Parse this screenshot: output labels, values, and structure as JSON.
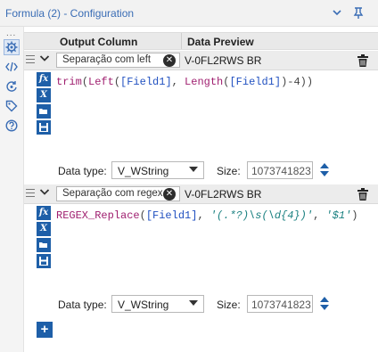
{
  "window": {
    "title": "Formula (2) - Configuration",
    "collapse_icon": "chevron-down-icon",
    "pin_icon": "pin-icon"
  },
  "sidebar": {
    "more_label": "...",
    "items": [
      {
        "name": "gear-icon",
        "glyph": "⚙"
      },
      {
        "name": "code-icon",
        "glyph": "</>"
      },
      {
        "name": "rename-icon",
        "glyph": "⟳"
      },
      {
        "name": "tag-icon",
        "glyph": "⌂"
      },
      {
        "name": "help-icon",
        "glyph": "?"
      }
    ]
  },
  "table": {
    "header_output": "Output Column",
    "header_preview": "Data Preview"
  },
  "formulas": [
    {
      "column": "Separação com left",
      "preview": "V-0FL2RWS BR",
      "expression": {
        "a": "trim",
        "b": "(",
        "c": "Left",
        "d": "(",
        "e": "[Field1]",
        "f": ", ",
        "g": "Length",
        "h": "(",
        "i": "[Field1]",
        "j": ")-4))"
      },
      "data_type_label": "Data type:",
      "data_type": "V_WString",
      "size_label": "Size:",
      "size": "1073741823"
    },
    {
      "column": "Separação com regex",
      "preview": "V-0FL2RWS BR",
      "expression": {
        "a": "REGEX_Replace",
        "b": "(",
        "c": "[Field1]",
        "d": ", ",
        "e": "'(.*?)\\s(\\d{4})'",
        "f": ", ",
        "g": "'$1'",
        "h": ")"
      },
      "data_type_label": "Data type:",
      "data_type": "V_WString",
      "size_label": "Size:",
      "size": "1073741823"
    }
  ],
  "tools": [
    "fx",
    "X",
    "open",
    "save"
  ],
  "add_label": "+",
  "colors": {
    "accent": "#1e5fa8",
    "function": "#a02070",
    "field": "#2050c0",
    "string": "#1a8080"
  }
}
